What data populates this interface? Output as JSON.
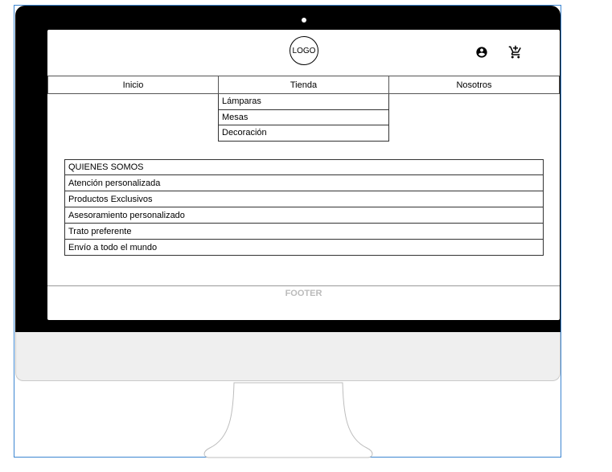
{
  "header": {
    "logo": "LOGO",
    "icons": [
      "account-circle-icon",
      "add-to-cart-icon"
    ]
  },
  "nav": {
    "items": [
      "Inicio",
      "Tienda",
      "Nosotros"
    ]
  },
  "dropdown": {
    "items": [
      "Lámparas",
      "Mesas",
      "Decoración"
    ]
  },
  "about": {
    "title": "QUIENES SOMOS",
    "items": [
      "Atención personalizada",
      "Productos Exclusivos",
      "Asesoramiento personalizado",
      "Trato preferente",
      "Envío a todo el mundo"
    ]
  },
  "footer": {
    "label": "FOOTER"
  },
  "colors": {
    "bezel": "#000000",
    "stand": "#efefef",
    "selection": "#3c86d1",
    "footer_text": "#bbbbbb"
  }
}
